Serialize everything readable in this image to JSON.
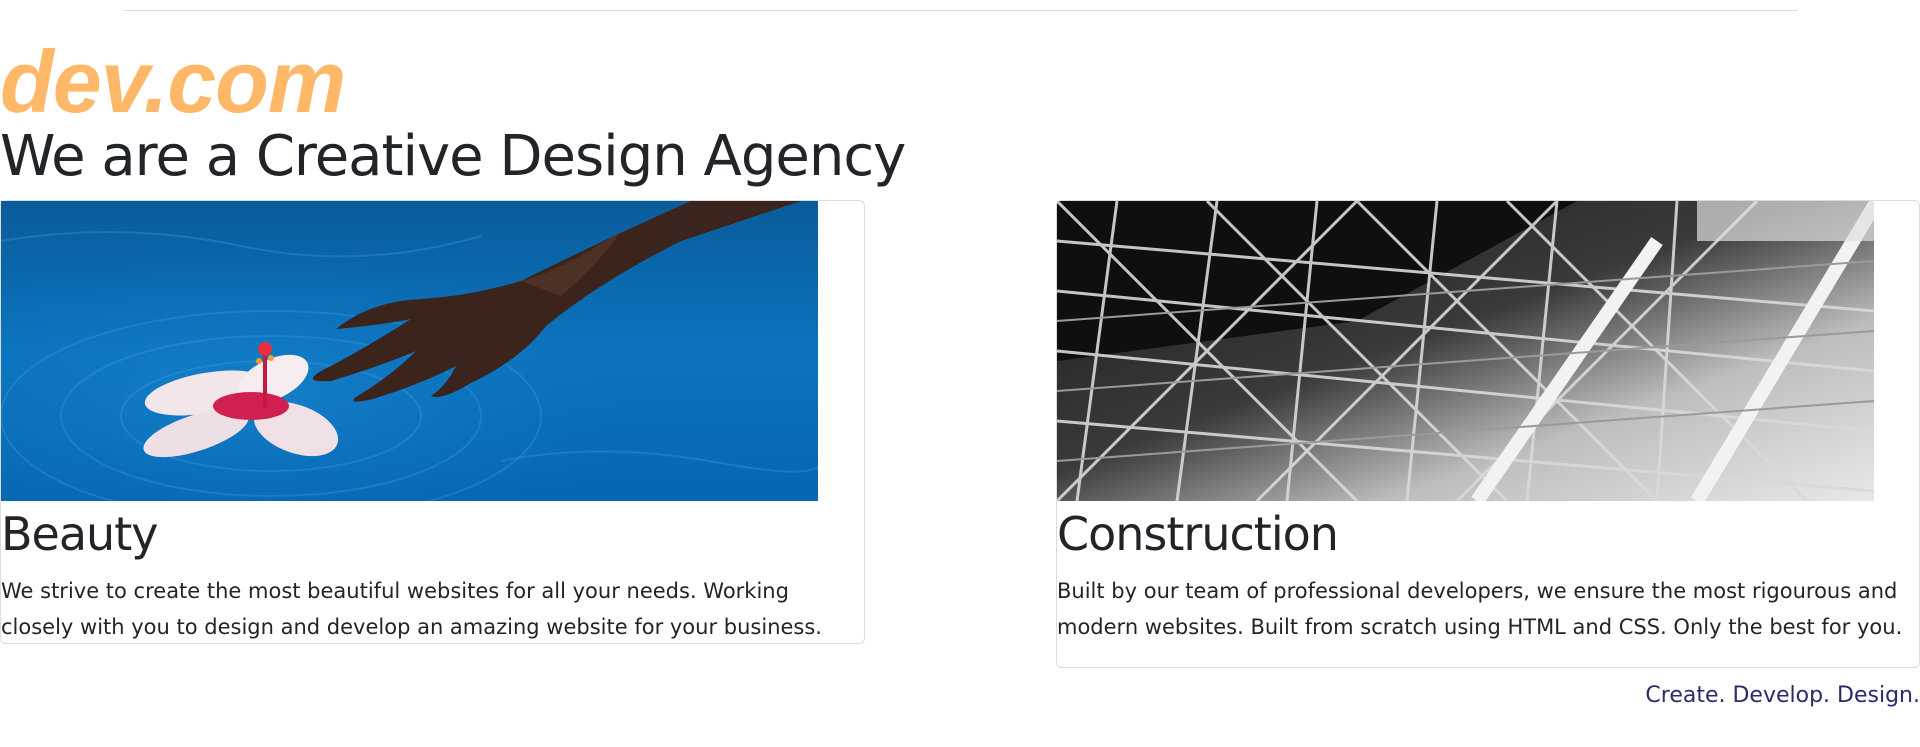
{
  "brand": {
    "logo_text": "dev.com",
    "logo_color": "#ffb867"
  },
  "hero": {
    "heading": "We are a Creative Design Agency"
  },
  "cards": [
    {
      "image": "hand-touching-water-with-hibiscus-flower",
      "title": "Beauty",
      "text": "We strive to create the most beautiful websites for all your needs. Working closely with you to design and develop an amazing website for your business."
    },
    {
      "image": "steel-structure-black-and-white",
      "title": "Construction",
      "text": "Built by our team of professional developers, we ensure the most rigourous and modern websites. Built from scratch using HTML and CSS. Only the best for you."
    }
  ],
  "footer": {
    "tagline": "Create. Develop. Design.",
    "tagline_color": "#2b2a6f"
  }
}
